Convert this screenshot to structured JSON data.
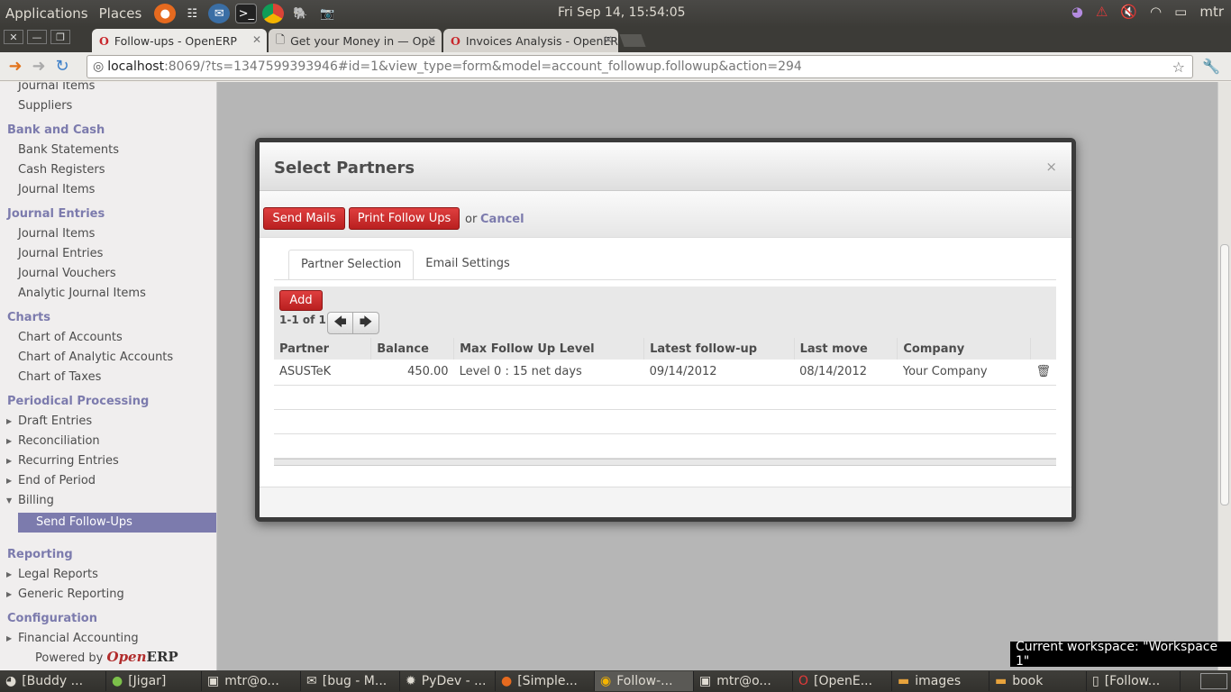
{
  "top_panel": {
    "applications": "Applications",
    "places": "Places",
    "clock": "Fri Sep 14, 15:54:05",
    "user": "mtr"
  },
  "browser": {
    "tabs": [
      {
        "label": "Follow-ups - OpenERP"
      },
      {
        "label": "Get your Money in — Ope"
      },
      {
        "label": "Invoices Analysis - OpenER"
      }
    ],
    "url_host": "localhost",
    "url_rest": ":8069/?ts=1347599393946#id=1&view_type=form&model=account_followup.followup&action=294"
  },
  "sidebar": {
    "items_top": [
      {
        "type": "item",
        "label": "Journal Items"
      },
      {
        "type": "item",
        "label": "Suppliers"
      }
    ],
    "sections": [
      {
        "title": "Bank and Cash",
        "items": [
          "Bank Statements",
          "Cash Registers",
          "Journal Items"
        ]
      },
      {
        "title": "Journal Entries",
        "items": [
          "Journal Items",
          "Journal Entries",
          "Journal Vouchers",
          "Analytic Journal Items"
        ]
      },
      {
        "title": "Charts",
        "items": [
          "Chart of Accounts",
          "Chart of Analytic Accounts",
          "Chart of Taxes"
        ]
      },
      {
        "title": "Periodical Processing",
        "items": [
          "Draft Entries",
          "Reconciliation",
          "Recurring Entries",
          "End of Period",
          "Billing"
        ]
      },
      {
        "title": "Reporting",
        "items": [
          "Legal Reports",
          "Generic Reporting"
        ]
      },
      {
        "title": "Configuration",
        "items": [
          "Financial Accounting"
        ]
      }
    ],
    "active_item": "Send Follow-Ups",
    "powered_by": "Powered by",
    "brand_open": "Open",
    "brand_erp": "ERP"
  },
  "modal": {
    "title": "Select Partners",
    "close": "×",
    "send_mails": "Send Mails",
    "print_follow_ups": "Print Follow Ups",
    "or": "or",
    "cancel": "Cancel",
    "tabs": [
      "Partner Selection",
      "Email Settings"
    ],
    "add": "Add",
    "pager": "1-1 of 1",
    "columns": [
      "Partner",
      "Balance",
      "Max Follow Up Level",
      "Latest follow-up",
      "Last move",
      "Company"
    ],
    "rows": [
      {
        "partner": "ASUSTeK",
        "balance": "450.00",
        "level": "Level 0 : 15 net days",
        "latest": "09/14/2012",
        "last_move": "08/14/2012",
        "company": "Your Company"
      }
    ]
  },
  "taskbar": {
    "items": [
      "[Buddy ...",
      "[Jigar]",
      "mtr@o...",
      "[bug - M...",
      "PyDev - ...",
      "[Simple...",
      "Follow-...",
      "mtr@o...",
      "[OpenE...",
      "images",
      "book",
      "[Follow..."
    ],
    "workspace_tip": "Current workspace: \"Workspace 1\""
  }
}
